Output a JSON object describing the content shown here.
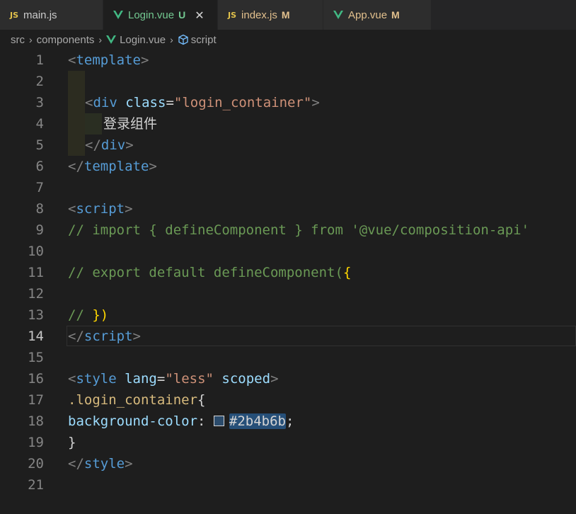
{
  "tabs": [
    {
      "icon": "JS",
      "name": "main.js",
      "status": "",
      "color": "#cccccc",
      "active": false
    },
    {
      "icon": "vue",
      "name": "Login.vue",
      "status": "U",
      "color": "#73c991",
      "active": true
    },
    {
      "icon": "JS",
      "name": "index.js",
      "status": "M",
      "color": "#e2c08d",
      "active": false
    },
    {
      "icon": "vue",
      "name": "App.vue",
      "status": "M",
      "color": "#e2c08d",
      "active": false
    }
  ],
  "breadcrumb": {
    "parts": [
      "src",
      "components",
      "Login.vue",
      "script"
    ]
  },
  "editor": {
    "current_line": 14,
    "line_numbers": [
      "1",
      "2",
      "3",
      "4",
      "5",
      "6",
      "7",
      "8",
      "9",
      "10",
      "11",
      "12",
      "13",
      "14",
      "15",
      "16",
      "17",
      "18",
      "19",
      "20",
      "21"
    ],
    "code": {
      "l1": [
        "<",
        "template",
        ">"
      ],
      "l3": [
        "<",
        "div",
        " ",
        "class",
        "=",
        "\"login_container\"",
        ">"
      ],
      "l4": "登录组件",
      "l5": [
        "</",
        "div",
        ">"
      ],
      "l6": [
        "</",
        "template",
        ">"
      ],
      "l8": [
        "<",
        "script",
        ">"
      ],
      "l9": "// import { defineComponent } from '@vue/composition-api'",
      "l11a": "// export default defineComponent(",
      "l11b": "{",
      "l13a": "// ",
      "l13b": "})",
      "l14": [
        "</",
        "script",
        ">"
      ],
      "l16": [
        "<",
        "style",
        " ",
        "lang",
        "=",
        "\"less\"",
        " ",
        "scoped",
        ">"
      ],
      "l17a": ".login_container",
      "l17b": "{",
      "l18a": "background-color",
      "l18b": ": ",
      "l18c": "#2b4b6b",
      "l18d": ";",
      "l19": "}",
      "l20": [
        "</",
        "style",
        ">"
      ]
    },
    "swatch_color": "#2b4b6b"
  }
}
